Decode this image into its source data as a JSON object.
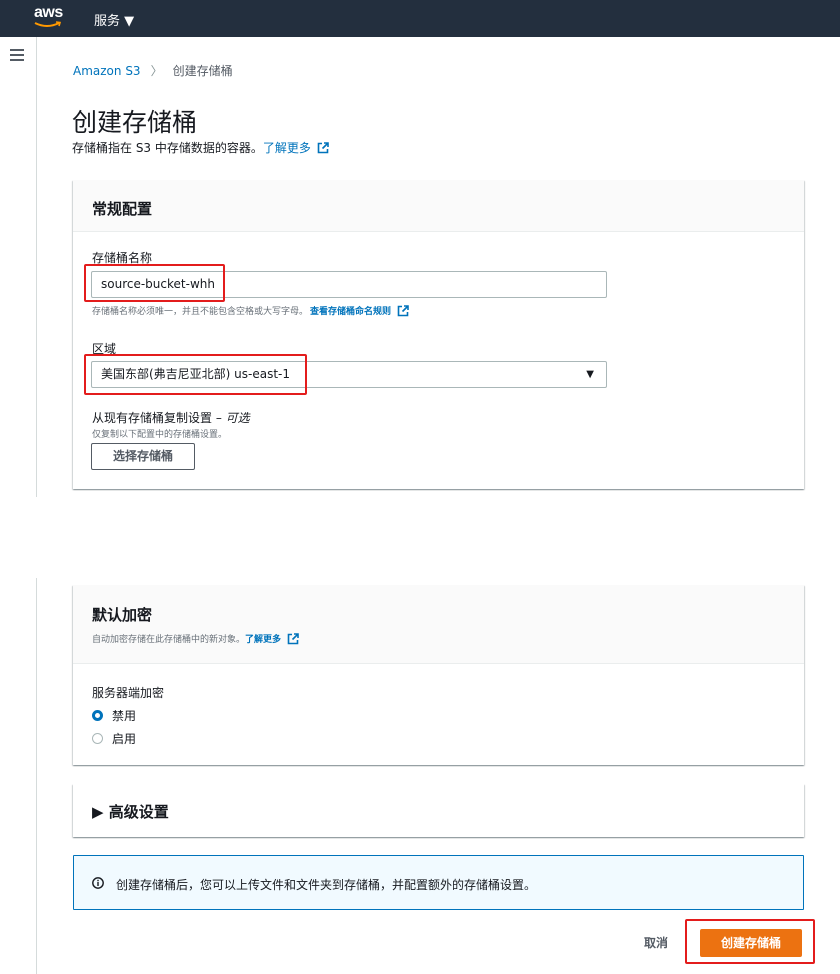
{
  "topbar": {
    "logo_text": "aws",
    "services_label": "服务 ▼"
  },
  "breadcrumb": {
    "root": "Amazon S3",
    "separator": "〉",
    "current": "创建存储桶"
  },
  "page": {
    "title": "创建存储桶",
    "description": "存储桶指在 S3 中存储数据的容器。",
    "learn_more": "了解更多"
  },
  "general_config": {
    "title": "常规配置",
    "bucket_name_label": "存储桶名称",
    "bucket_name_value": "source-bucket-whh",
    "bucket_name_hint": "存储桶名称必须唯一，并且不能包含空格或大写字母。",
    "naming_rules_link": "查看存储桶命名规则",
    "region_label": "区域",
    "region_value": "美国东部(弗吉尼亚北部) us-east-1",
    "copy_settings_label": "从现有存储桶复制设置 – ",
    "copy_settings_optional": "可选",
    "copy_settings_hint": "仅复制以下配置中的存储桶设置。",
    "choose_bucket_button": "选择存储桶"
  },
  "encryption": {
    "title": "默认加密",
    "subtitle": "自动加密存储在此存储桶中的新对象。",
    "learn_more": "了解更多",
    "sse_label": "服务器端加密",
    "options": [
      "禁用",
      "启用"
    ],
    "selected": "禁用"
  },
  "advanced": {
    "title": "▶ 高级设置"
  },
  "info": {
    "text": "创建存储桶后，您可以上传文件和文件夹到存储桶，并配置额外的存储桶设置。"
  },
  "actions": {
    "cancel": "取消",
    "create": "创建存储桶"
  },
  "colors": {
    "topbar": "#232f3e",
    "link": "#0073bb",
    "primary": "#ec7211",
    "highlight": "#e31c1c"
  }
}
